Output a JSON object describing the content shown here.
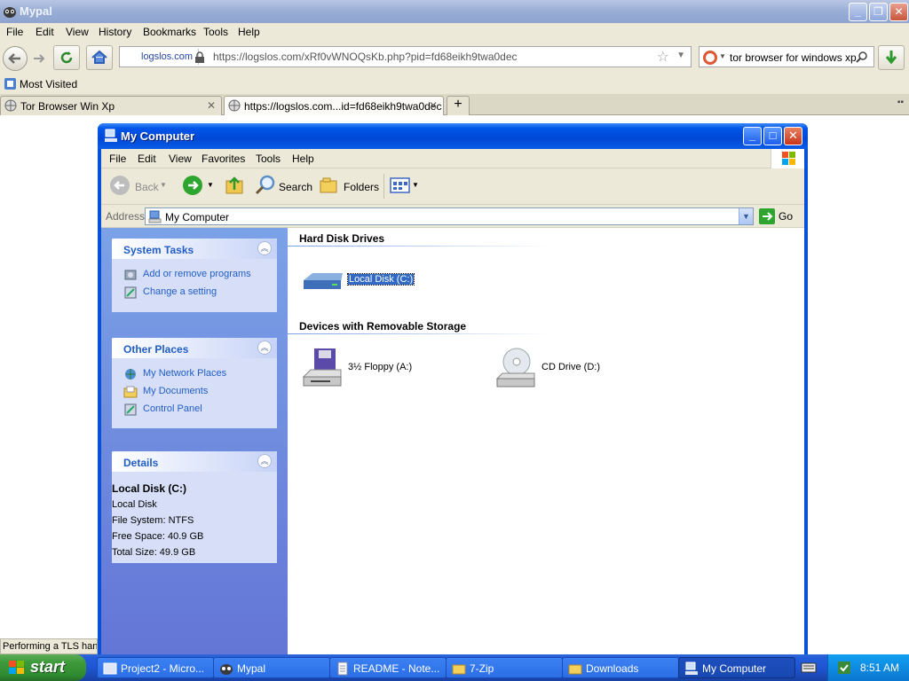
{
  "browser": {
    "title": "Mypal",
    "menu": [
      "File",
      "Edit",
      "View",
      "History",
      "Bookmarks",
      "Tools",
      "Help"
    ],
    "site_identity": "logslos.com",
    "url": "https://logslos.com/xRf0vWNOQsKb.php?pid=fd68eikh9twa0dec",
    "search_query": "tor browser for windows xp",
    "bookmarks_label": "Most Visited",
    "tabs": [
      {
        "label": "Tor Browser Win Xp",
        "active": false
      },
      {
        "label": "https://logslos.com...id=fd68eikh9twa0dec",
        "active": true
      }
    ],
    "status": "Performing a TLS handshake"
  },
  "window": {
    "title": "My Computer",
    "menu": [
      "File",
      "Edit",
      "View",
      "Favorites",
      "Tools",
      "Help"
    ],
    "toolbar": {
      "back": "Back",
      "search": "Search",
      "folders": "Folders"
    },
    "address_label": "Address",
    "address_value": "My Computer",
    "go_label": "Go",
    "panels": {
      "system_tasks": {
        "title": "System Tasks",
        "links": [
          "Add or remove programs",
          "Change a setting"
        ]
      },
      "other_places": {
        "title": "Other Places",
        "links": [
          "My Network Places",
          "My Documents",
          "Control Panel"
        ]
      },
      "details": {
        "title": "Details",
        "name": "Local Disk (C:)",
        "type": "Local Disk",
        "file_system": "File System: NTFS",
        "free_space": "Free Space: 40.9 GB",
        "total_size": "Total Size: 49.9 GB"
      }
    },
    "groups": {
      "hard_disks": {
        "title": "Hard Disk Drives",
        "drives": [
          "Local Disk (C:)"
        ]
      },
      "removable": {
        "title": "Devices with Removable Storage",
        "drives": [
          "3½ Floppy (A:)",
          "CD Drive (D:)"
        ]
      }
    }
  },
  "taskbar": {
    "start": "start",
    "tasks": [
      "Project2 - Micro...",
      "Mypal",
      "README - Note...",
      "7-Zip",
      "Downloads",
      "My Computer"
    ],
    "active_task": "My Computer",
    "clock": "8:51 AM"
  }
}
